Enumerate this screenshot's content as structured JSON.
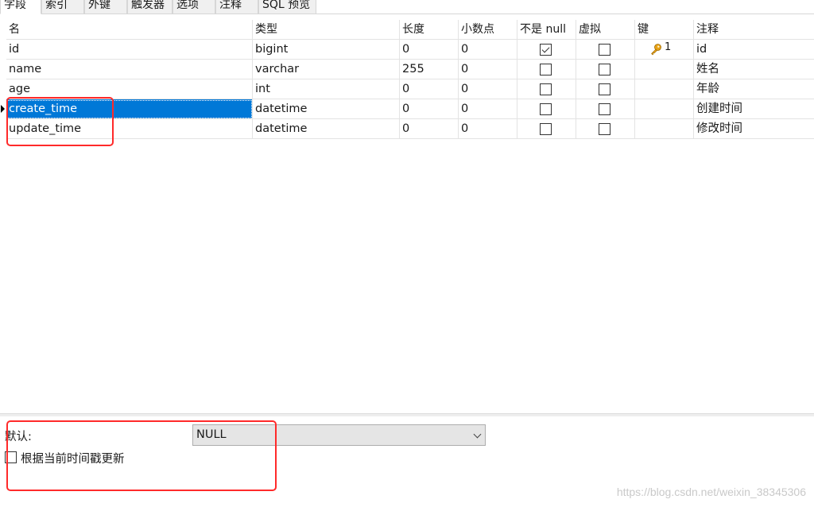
{
  "tabs": [
    "字段",
    "索引",
    "外键",
    "触发器",
    "选项",
    "注释",
    "SQL 预览"
  ],
  "columns": {
    "name": "名",
    "type": "类型",
    "length": "长度",
    "decimals": "小数点",
    "not_null": "不是 null",
    "virtual": "虚拟",
    "key": "键",
    "comment": "注释"
  },
  "rows": [
    {
      "name": "id",
      "type": "bigint",
      "length": "0",
      "decimals": "0",
      "not_null": true,
      "virtual": false,
      "key": "1",
      "comment": "id"
    },
    {
      "name": "name",
      "type": "varchar",
      "length": "255",
      "decimals": "0",
      "not_null": false,
      "virtual": false,
      "key": "",
      "comment": "姓名"
    },
    {
      "name": "age",
      "type": "int",
      "length": "0",
      "decimals": "0",
      "not_null": false,
      "virtual": false,
      "key": "",
      "comment": "年龄"
    },
    {
      "name": "create_time",
      "type": "datetime",
      "length": "0",
      "decimals": "0",
      "not_null": false,
      "virtual": false,
      "key": "",
      "comment": "创建时间"
    },
    {
      "name": "update_time",
      "type": "datetime",
      "length": "0",
      "decimals": "0",
      "not_null": false,
      "virtual": false,
      "key": "",
      "comment": "修改时间"
    }
  ],
  "selected_row": 3,
  "properties": {
    "default_label": "默认:",
    "default_value": "NULL",
    "on_update_label": "根据当前时间戳更新",
    "on_update_checked": false
  },
  "watermark": "https://blog.csdn.net/weixin_38345306",
  "colors": {
    "selection": "#0078d7",
    "annotation": "#ff2a2a",
    "key_icon": "#e8a317"
  },
  "icons": {
    "primary_key": "key-icon",
    "dropdown": "chevron-down-icon",
    "current_row": "row-pointer-icon"
  }
}
